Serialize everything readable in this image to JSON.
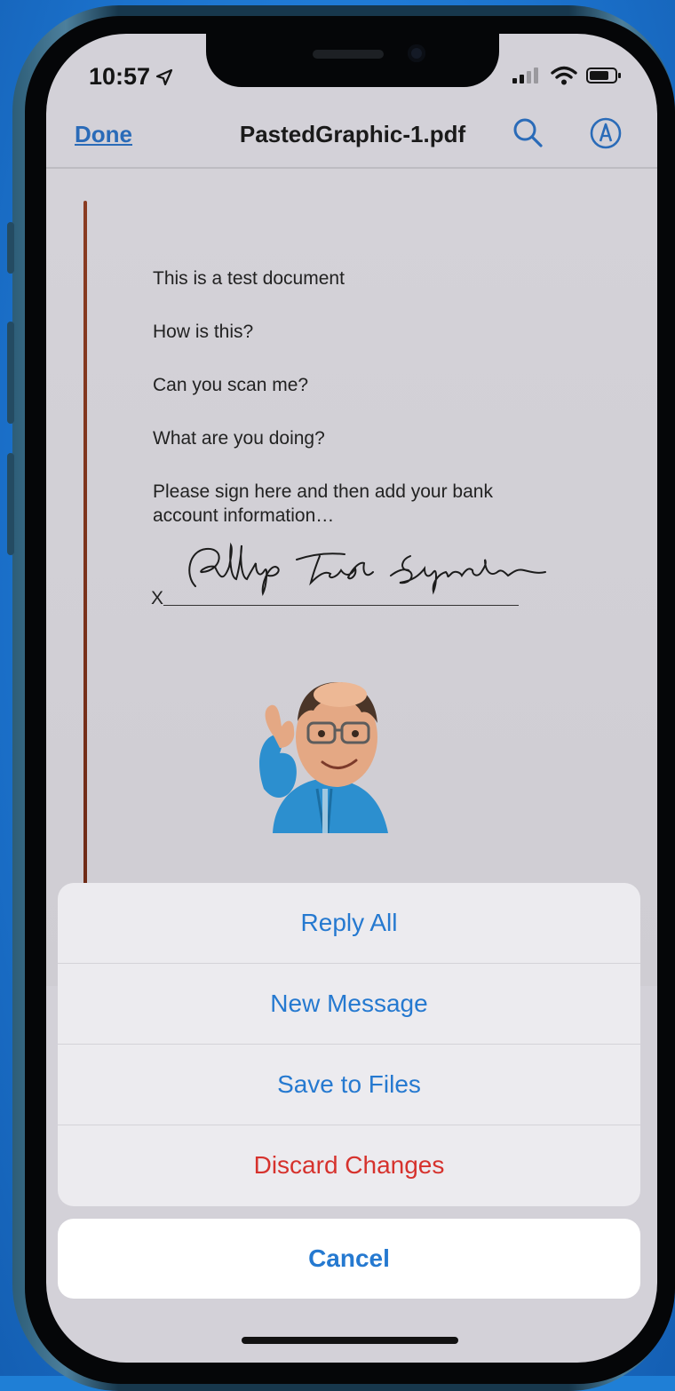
{
  "status_bar": {
    "time": "10:57"
  },
  "nav": {
    "done_label": "Done",
    "title": "PastedGraphic-1.pdf"
  },
  "document": {
    "lines": [
      "This is a test document",
      "How is this?",
      "Can you scan me?",
      "What are you doing?",
      "Please sign here and then add your bank",
      "account information…"
    ],
    "signature_prefix": "X",
    "signature_text": "Phillip Test Signature"
  },
  "action_sheet": {
    "items": [
      {
        "label": "Reply All",
        "style": "default"
      },
      {
        "label": "New Message",
        "style": "default"
      },
      {
        "label": "Save to Files",
        "style": "default"
      },
      {
        "label": "Discard Changes",
        "style": "destructive"
      }
    ],
    "cancel_label": "Cancel"
  },
  "colors": {
    "accent": "#2579d0",
    "destructive": "#d6322d",
    "background": "#1f7fd6"
  },
  "icons": [
    "location-arrow-icon",
    "signal-icon",
    "wifi-icon",
    "battery-icon",
    "search-icon",
    "markup-pen-icon"
  ]
}
